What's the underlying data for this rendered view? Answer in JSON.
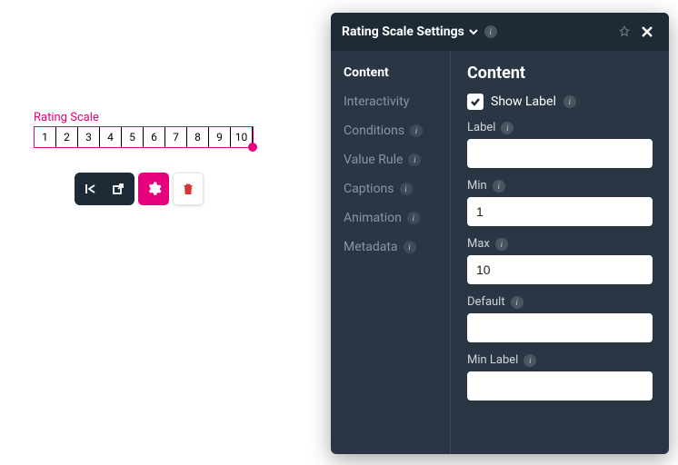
{
  "widget": {
    "label": "Rating Scale",
    "cells": [
      "1",
      "2",
      "3",
      "4",
      "5",
      "6",
      "7",
      "8",
      "9",
      "10"
    ]
  },
  "toolbar": {
    "insert_left": "insert-left-icon",
    "open_external": "open-external-icon",
    "settings": "settings-icon",
    "delete": "trash-icon"
  },
  "panel": {
    "title": "Rating Scale Settings",
    "nav": [
      {
        "label": "Content",
        "active": true,
        "info": false
      },
      {
        "label": "Interactivity",
        "active": false,
        "info": false
      },
      {
        "label": "Conditions",
        "active": false,
        "info": true
      },
      {
        "label": "Value Rule",
        "active": false,
        "info": true
      },
      {
        "label": "Captions",
        "active": false,
        "info": true
      },
      {
        "label": "Animation",
        "active": false,
        "info": true
      },
      {
        "label": "Metadata",
        "active": false,
        "info": true
      }
    ],
    "content": {
      "heading": "Content",
      "show_label_text": "Show Label",
      "show_label_checked": true,
      "fields": {
        "label": {
          "label": "Label",
          "value": ""
        },
        "min": {
          "label": "Min",
          "value": "1"
        },
        "max": {
          "label": "Max",
          "value": "10"
        },
        "default": {
          "label": "Default",
          "value": ""
        },
        "minlabel": {
          "label": "Min Label",
          "value": ""
        }
      }
    }
  }
}
